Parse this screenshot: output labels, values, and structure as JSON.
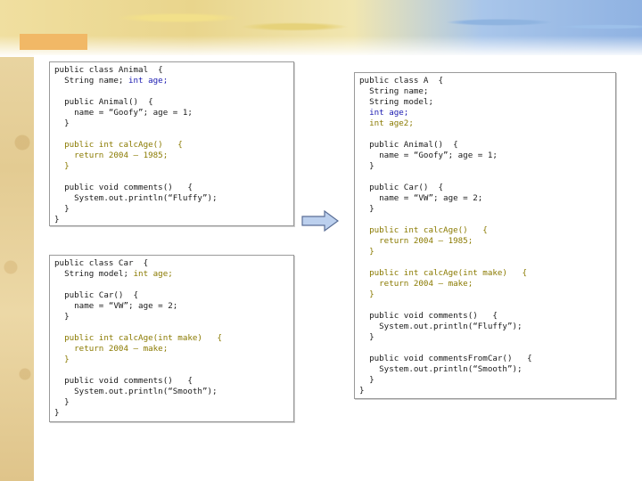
{
  "animal_class": {
    "l1": "public class Animal  {",
    "l2a": "  String name; ",
    "l2b": "int age;",
    "l3": "  public Animal()  {",
    "l4": "    name = “Goofy”; age = 1;",
    "l5": "  }",
    "l6": "  public int calcAge()   {",
    "l7": "    return 2004 – 1985;",
    "l8": "  }",
    "l9": "  public void comments()   {",
    "l10": "    System.out.println(“Fluffy”);",
    "l11": "  }",
    "l12": "}"
  },
  "car_class": {
    "l1": "public class Car  {",
    "l2a": "  String model; ",
    "l2b": "int age;",
    "l3": "  public Car()  {",
    "l4": "    name = “VW”; age = 2;",
    "l5": "  }",
    "l6": "  public int calcAge(int make)   {",
    "l7": "    return 2004 – make;",
    "l8": "  }",
    "l9": "  public void comments()   {",
    "l10": "    System.out.println(“Smooth”);",
    "l11": "  }",
    "l12": "}"
  },
  "a_class": {
    "l1": "public class A  {",
    "l2": "  String name;",
    "l3": "  String model;",
    "l4": "  int age;",
    "l5": "  int age2;",
    "l6": "  public Animal()  {",
    "l7": "    name = “Goofy”; age = 1;",
    "l8": "  }",
    "l9": "  public Car()  {",
    "l10": "    name = “VW”; age = 2;",
    "l11": "  }",
    "l12": "  public int calcAge()   {",
    "l13": "    return 2004 – 1985;",
    "l14": "  }",
    "l15": "  public int calcAge(int make)   {",
    "l16": "    return 2004 – make;",
    "l17": "  }",
    "l18": "  public void comments()   {",
    "l19": "    System.out.println(“Fluffy”);",
    "l20": "  }",
    "l21": "  public void commentsFromCar()   {",
    "l22": "    System.out.println(“Smooth”);",
    "l23": "  }",
    "l24": "}"
  },
  "colors": {
    "olive_highlight": "#8a7a00",
    "blue_highlight": "#1a1ab0",
    "arrow_fill": "#bcd0ee",
    "arrow_stroke": "#5a6e96"
  }
}
